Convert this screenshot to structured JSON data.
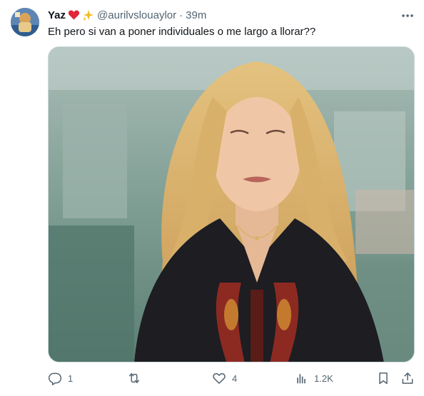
{
  "tweet": {
    "author_name": "Yaz",
    "author_handle": "@aurilvslouaylor",
    "separator": "·",
    "timestamp": "39m",
    "text": "Eh pero si van a poner individuales o me largo a llorar??",
    "name_emojis": [
      "red-heart-icon",
      "sparkles-icon"
    ]
  },
  "actions": {
    "reply_count": "1",
    "retweet_count": "",
    "like_count": "4",
    "views_count": "1.2K"
  },
  "colors": {
    "text_primary": "#0f1419",
    "text_secondary": "#536471",
    "border": "#cfd9de"
  }
}
